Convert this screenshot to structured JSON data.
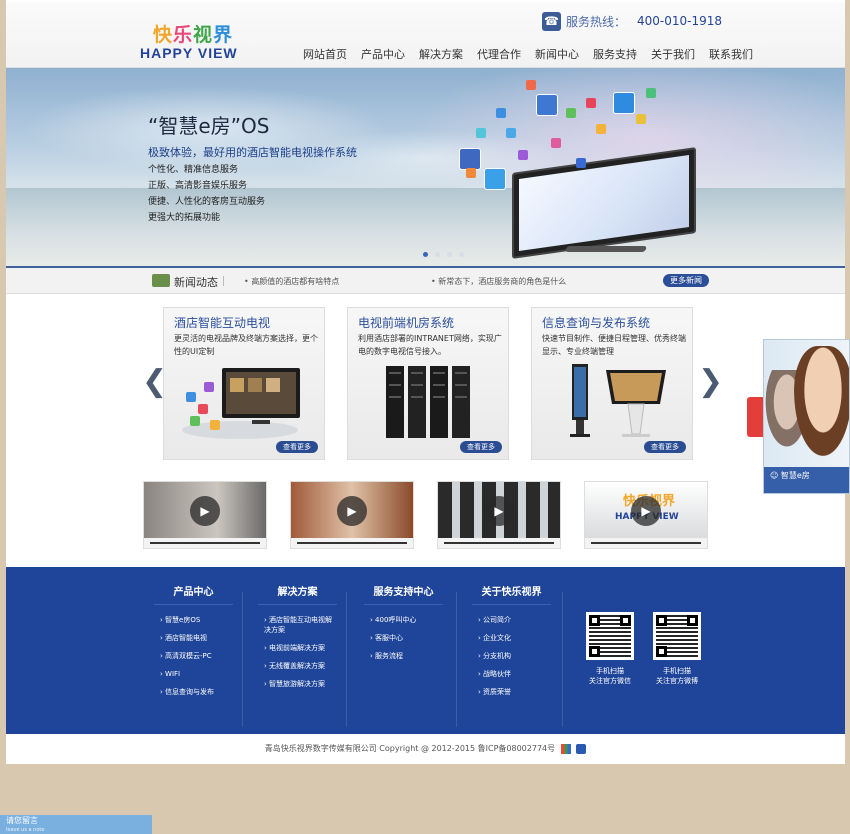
{
  "header": {
    "logo_cn": [
      "快",
      "乐",
      "视",
      "界"
    ],
    "logo_en": "HAPPY VIEW",
    "hotline_label": "服务热线：",
    "hotline_number": "400-010-1918",
    "nav": [
      "网站首页",
      "产品中心",
      "解决方案",
      "代理合作",
      "新闻中心",
      "服务支持",
      "关于我们",
      "联系我们"
    ]
  },
  "banner": {
    "title": "“智慧e房”OS",
    "subtitle": "极致体验，最好用的酒店智能电视操作系统",
    "features": [
      "个性化、精准信息服务",
      "正版、高清影音娱乐服务",
      "便捷、人性化的客房互动服务",
      "更强大的拓展功能"
    ],
    "active_slide": 1,
    "slide_count": 4
  },
  "news": {
    "title": "新闻动态",
    "items": [
      "高颜值的酒店都有啥特点",
      "新常态下，酒店服务商的角色是什么"
    ],
    "more": "更多新闻"
  },
  "cards": [
    {
      "title": "酒店智能互动电视",
      "desc": "更灵活的电视品牌及终端方案选择，更个性的UI定制",
      "more": "查看更多"
    },
    {
      "title": "电视前端机房系统",
      "desc": "利用酒店部署的INTRANET网络，实现广电的数字电视信号接入。",
      "more": "查看更多"
    },
    {
      "title": "信息查询与发布系统",
      "desc": "快速节目制作、便捷日程管理、优秀终端显示、专业终端管理",
      "more": "查看更多"
    }
  ],
  "arrows": {
    "prev": "❮",
    "next": "❯"
  },
  "videos": [
    {
      "play": "▶"
    },
    {
      "play": "▶"
    },
    {
      "play": "▶"
    },
    {
      "play": "▶",
      "logo_cn": "快乐视界",
      "logo_en": "HAPPY VIEW"
    }
  ],
  "footer": {
    "columns": [
      {
        "title": "产品中心",
        "items": [
          "智慧e房OS",
          "酒店智能电视",
          "高清双模云-PC",
          "WIFI",
          "信息查询与发布"
        ]
      },
      {
        "title": "解决方案",
        "items": [
          "酒店智能互动电视解决方案",
          "电视前端解决方案",
          "无线覆盖解决方案",
          "智慧旅游解决方案"
        ]
      },
      {
        "title": "服务支持中心",
        "items": [
          "400呼叫中心",
          "客服中心",
          "服务流程"
        ]
      },
      {
        "title": "关于快乐视界",
        "items": [
          "公司简介",
          "企业文化",
          "分支机构",
          "战略伙伴",
          "资质荣誉"
        ]
      }
    ],
    "qr": [
      {
        "caption_1": "手机扫描",
        "caption_2": "关注官方微信"
      },
      {
        "caption_1": "手机扫描",
        "caption_2": "关注官方微博"
      }
    ],
    "copyright": "青岛快乐视界数字传媒有限公司 Copyright @ 2012-2015 鲁ICP备08002774号"
  },
  "side_widget": {
    "label": "智慧e房"
  },
  "chat_tab": {
    "label": "请您留言",
    "sub": "leave us a note"
  },
  "colors": {
    "brand_blue": "#1f459a",
    "accent_green": "#9bc25a",
    "link_blue": "#2a4f9b"
  }
}
